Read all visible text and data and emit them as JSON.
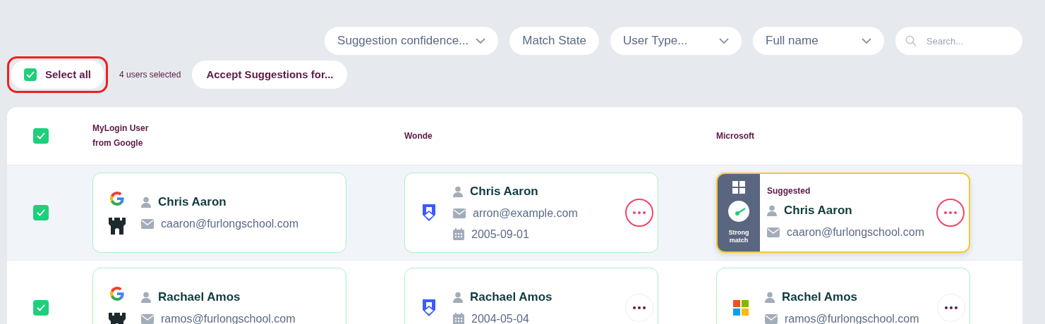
{
  "filters": [
    {
      "kind": "dropdown",
      "label": "Suggestion confidence..."
    },
    {
      "kind": "button",
      "label": "Match State"
    },
    {
      "kind": "dropdown",
      "label": "User Type..."
    },
    {
      "kind": "dropdown",
      "label": "Full name"
    },
    {
      "kind": "search",
      "placeholder": "Search..."
    }
  ],
  "select_all": {
    "label": "Select all",
    "checked": true,
    "highlighted": true
  },
  "selection_count": "4 users selected",
  "accept_button": "Accept Suggestions for...",
  "table": {
    "header_checked": true,
    "columns": [
      "MyLogin User from Google",
      "Wonde",
      "Microsoft"
    ],
    "rows": [
      {
        "checked": true,
        "cells": [
          {
            "kind": "google",
            "suggested": false,
            "name": "Chris Aaron",
            "fields": [
              {
                "kind": "email",
                "text": "caaron@furlongschool.com"
              }
            ]
          },
          {
            "kind": "wonde",
            "suggested": false,
            "name": "Chris Aaron",
            "fields": [
              {
                "kind": "email",
                "text": "arron@example.com"
              },
              {
                "kind": "date",
                "text": "2005-09-01"
              }
            ],
            "more_highlighted": true
          },
          {
            "kind": "microsoft",
            "suggested": true,
            "tag": "Suggested",
            "match": "Strong match",
            "name": "Chris Aaron",
            "fields": [
              {
                "kind": "email",
                "text": "caaron@furlongschool.com"
              }
            ],
            "more_highlighted": true
          }
        ]
      },
      {
        "checked": true,
        "cells": [
          {
            "kind": "google",
            "suggested": false,
            "name": "Rachael Amos",
            "fields": [
              {
                "kind": "email",
                "text": "ramos@furlongschool.com"
              }
            ]
          },
          {
            "kind": "wonde",
            "suggested": false,
            "name": "Rachael Amos",
            "fields": [
              {
                "kind": "date",
                "text": "2004-05-04"
              }
            ],
            "more_highlighted": false
          },
          {
            "kind": "microsoft",
            "suggested": false,
            "name": "Rachel Amos",
            "fields": [
              {
                "kind": "email",
                "text": "ramos@furlongschool.com"
              }
            ],
            "more_highlighted": false
          }
        ]
      }
    ]
  }
}
